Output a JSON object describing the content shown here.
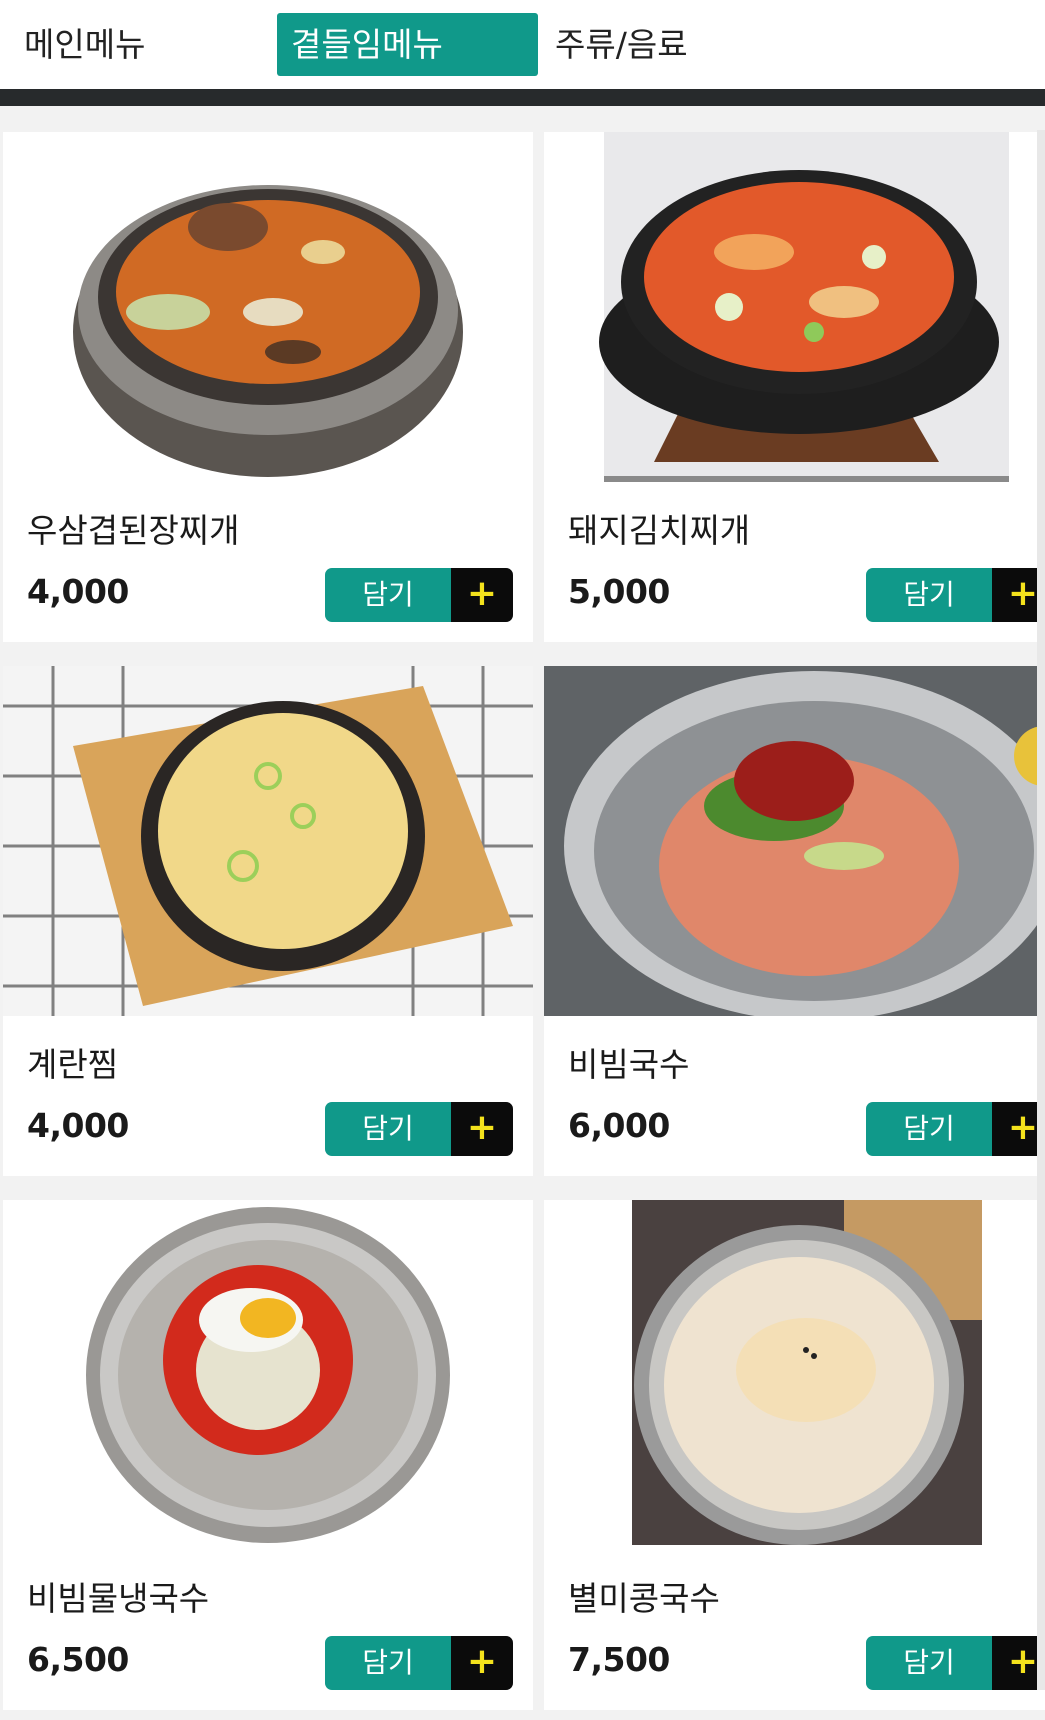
{
  "tabs": [
    {
      "label": "메인메뉴",
      "active": false
    },
    {
      "label": "곁들임메뉴",
      "active": true
    },
    {
      "label": "주류/음료",
      "active": false
    }
  ],
  "accent_color": "#10998a",
  "items": [
    {
      "name": "우삼겹된장찌개",
      "price": "4,000",
      "add_label": "담기",
      "add_icon": "+"
    },
    {
      "name": "돼지김치찌개",
      "price": "5,000",
      "add_label": "담기",
      "add_icon": "+"
    },
    {
      "name": "계란찜",
      "price": "4,000",
      "add_label": "담기",
      "add_icon": "+"
    },
    {
      "name": "비빔국수",
      "price": "6,000",
      "add_label": "담기",
      "add_icon": "+"
    },
    {
      "name": "비빔물냉국수",
      "price": "6,500",
      "add_label": "담기",
      "add_icon": "+"
    },
    {
      "name": "별미콩국수",
      "price": "7,500",
      "add_label": "담기",
      "add_icon": "+"
    }
  ]
}
